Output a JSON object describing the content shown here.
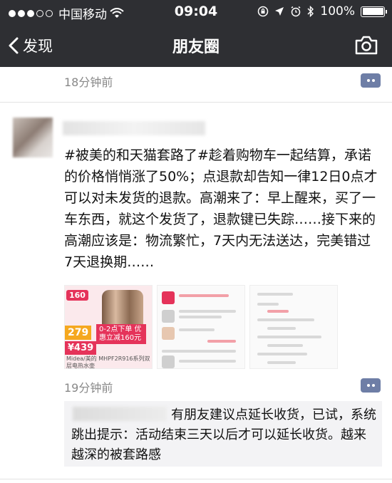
{
  "status_bar": {
    "carrier": "中国移动",
    "time": "09:04",
    "battery": "100%",
    "signal_bars_filled": 3
  },
  "nav": {
    "back_label": "发现",
    "title": "朋友圈"
  },
  "prev_post": {
    "timestamp": "18分钟前"
  },
  "post": {
    "text": "#被美的和天猫套路了#趁着购物车一起结算，承诺的价格悄悄涨了50%；点退款却告知一律12日0点才可以对未发货的退款。高潮来了：早上醒来，买了一车东西，就这个发货了，退款键已失踪……接下来的高潮应该是：物流繁忙，7天内无法送达，完美错过7天退换期……",
    "timestamp": "19分钟前",
    "images": {
      "image1": {
        "badge": "160",
        "price_main": "279",
        "promo": "0-2点下单 优惠立减160元",
        "price_final": "¥439",
        "caption": "Midea/美的 MHPF2R916系列双层电热水壶"
      }
    }
  },
  "reply": {
    "text": "有朋友建议点延长收货，已试，系统跳出提示：活动结束三天以后才可以延长收货。越来越深的被套路感"
  },
  "colors": {
    "nav_bg": "#2e2f33",
    "comment_button": "#6e7ea6",
    "timestamp_gray": "#888888"
  }
}
